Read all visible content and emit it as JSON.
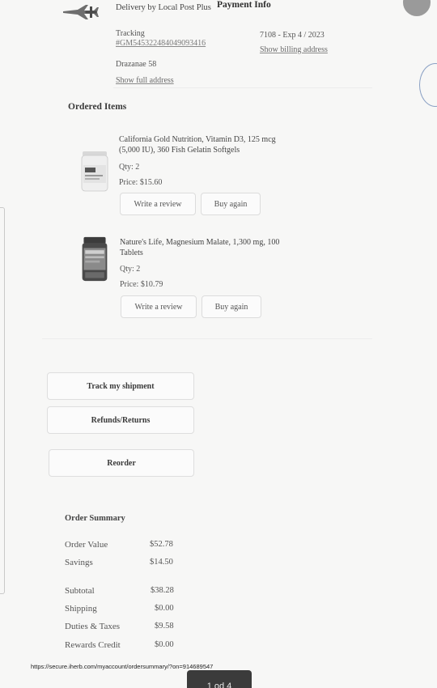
{
  "shipping": {
    "method": "Delivery by Local Post Plus",
    "tracking_label": "Tracking",
    "tracking_number": "#GM545322484049093416",
    "address_line": "Drazanae 58",
    "full_address_link": "Show full address"
  },
  "payment": {
    "heading": "Payment Info",
    "card": "7108 - Exp 4 / 2023",
    "billing_link": "Show billing address"
  },
  "ordered_items": {
    "heading": "Ordered Items",
    "items": [
      {
        "name": "California Gold Nutrition, Vitamin D3, 125 mcg (5,000 IU), 360 Fish Gelatin Softgels",
        "qty": "Qty: 2",
        "price": "Price: $15.60",
        "review_label": "Write a review",
        "buy_label": "Buy again"
      },
      {
        "name": "Nature's Life, Magnesium Malate, 1,300 mg, 100 Tablets",
        "qty": "Qty: 2",
        "price": "Price: $10.79",
        "review_label": "Write a review",
        "buy_label": "Buy again"
      }
    ]
  },
  "actions": {
    "track": "Track my shipment",
    "refunds": "Refunds/Returns",
    "reorder": "Reorder"
  },
  "order_summary": {
    "heading": "Order Summary",
    "rows": [
      {
        "label": "Order Value",
        "value": "$52.78"
      },
      {
        "label": "Savings",
        "value": "$14.50"
      },
      {
        "label": "Subtotal",
        "value": "$38.28"
      },
      {
        "label": "Shipping",
        "value": "$0.00"
      },
      {
        "label": "Duties & Taxes",
        "value": "$9.58"
      },
      {
        "label": "Rewards Credit",
        "value": "$0.00"
      }
    ]
  },
  "footer": {
    "url": "https://secure.iherb.com/myaccount/ordersummary/?on=914689547",
    "page_indicator": "1 od 4"
  },
  "colors": {
    "page_bg": "#f7f7f6",
    "text": "#3a3a3a",
    "button_border": "#dcdcdc",
    "page_indicator_bg": "#3b3b3b"
  }
}
